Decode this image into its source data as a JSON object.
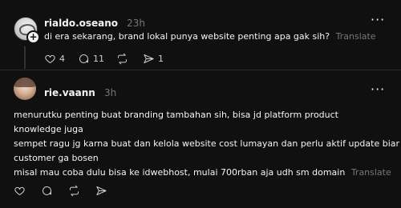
{
  "posts": [
    {
      "username": "rialdo.oseano",
      "time": "23h",
      "text": "di era sekarang, brand lokal punya website penting apa gak sih?",
      "translate_label": "Translate",
      "likes": "4",
      "replies": "11",
      "reposts": "",
      "shares": "1"
    },
    {
      "username": "rie.vaann",
      "time": "3h",
      "lines": [
        "menurutku penting buat branding tambahan sih, bisa jd platform product",
        "knowledge juga",
        "sempet ragu jg karna buat dan kelola website cost lumayan dan perlu aktif update biar",
        "customer ga bosen",
        "misal mau coba dulu bisa ke idwebhost, mulai 700rban aja udh sm domain"
      ],
      "translate_label": "Translate"
    }
  ],
  "more_label": "···"
}
